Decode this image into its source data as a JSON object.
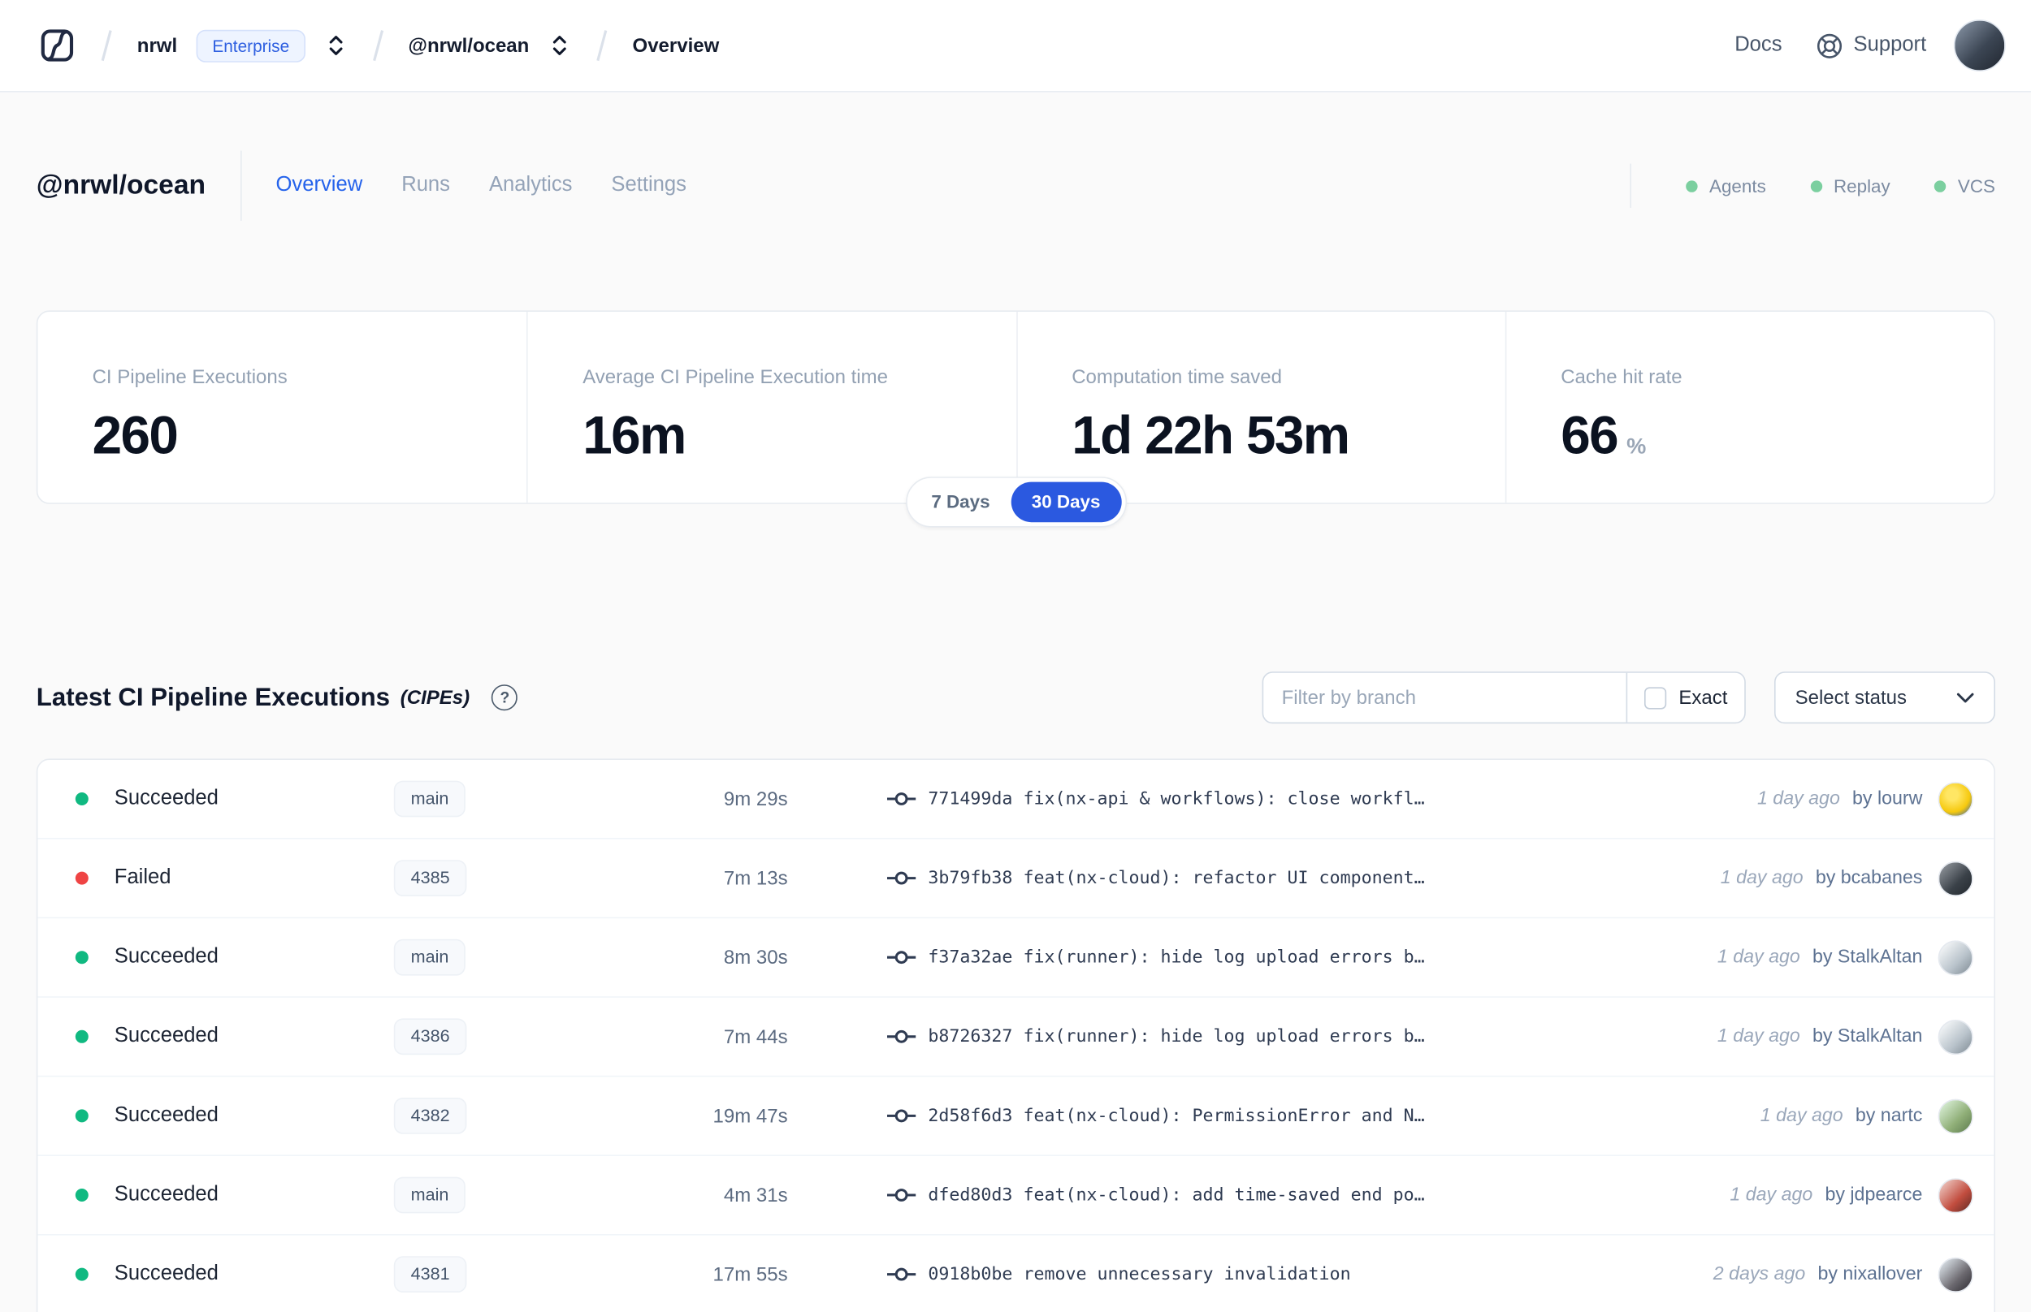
{
  "topbar": {
    "breadcrumb": {
      "org": "nrwl",
      "org_badge": "Enterprise",
      "workspace": "@nrwl/ocean",
      "page": "Overview"
    },
    "docs_label": "Docs",
    "support_label": "Support"
  },
  "workspace": {
    "title": "@nrwl/ocean",
    "tabs": [
      {
        "label": "Overview",
        "active": true
      },
      {
        "label": "Runs",
        "active": false
      },
      {
        "label": "Analytics",
        "active": false
      },
      {
        "label": "Settings",
        "active": false
      }
    ],
    "status_indicators": [
      {
        "label": "Agents"
      },
      {
        "label": "Replay"
      },
      {
        "label": "VCS"
      }
    ]
  },
  "stats": {
    "cards": [
      {
        "label": "CI Pipeline Executions",
        "value": "260"
      },
      {
        "label": "Average CI Pipeline Execution time",
        "value": "16m"
      },
      {
        "label": "Computation time saved",
        "value": "1d 22h 53m"
      },
      {
        "label": "Cache hit rate",
        "value": "66",
        "unit": "%"
      }
    ],
    "range_toggle": {
      "inactive": "7 Days",
      "active": "30 Days"
    }
  },
  "cipes": {
    "title": "Latest CI Pipeline Executions",
    "title_suffix": "(CIPEs)",
    "help_glyph": "?",
    "filter": {
      "placeholder": "Filter by branch",
      "exact_label": "Exact",
      "exact_checked": false
    },
    "status_select_label": "Select status",
    "rows": [
      {
        "status": "Succeeded",
        "status_color": "green",
        "branch": "main",
        "duration": "9m 29s",
        "commit": "771499da fix(nx-api & workflows): close workfl…",
        "time": "1 day ago",
        "author": "by lourw"
      },
      {
        "status": "Failed",
        "status_color": "red",
        "branch": "4385",
        "duration": "7m 13s",
        "commit": "3b79fb38 feat(nx-cloud): refactor UI component…",
        "time": "1 day ago",
        "author": "by bcabanes"
      },
      {
        "status": "Succeeded",
        "status_color": "green",
        "branch": "main",
        "duration": "8m 30s",
        "commit": "f37a32ae fix(runner): hide log upload errors b…",
        "time": "1 day ago",
        "author": "by StalkAltan"
      },
      {
        "status": "Succeeded",
        "status_color": "green",
        "branch": "4386",
        "duration": "7m 44s",
        "commit": "b8726327 fix(runner): hide log upload errors b…",
        "time": "1 day ago",
        "author": "by StalkAltan"
      },
      {
        "status": "Succeeded",
        "status_color": "green",
        "branch": "4382",
        "duration": "19m 47s",
        "commit": "2d58f6d3 feat(nx-cloud): PermissionError and N…",
        "time": "1 day ago",
        "author": "by nartc"
      },
      {
        "status": "Succeeded",
        "status_color": "green",
        "branch": "main",
        "duration": "4m 31s",
        "commit": "dfed80d3 feat(nx-cloud): add time-saved end po…",
        "time": "1 day ago",
        "author": "by jdpearce"
      },
      {
        "status": "Succeeded",
        "status_color": "green",
        "branch": "4381",
        "duration": "17m 55s",
        "commit": "0918b0be remove unnecessary invalidation",
        "time": "2 days ago",
        "author": "by nixallover"
      }
    ]
  },
  "colors": {
    "accent_blue": "#2563eb",
    "toggle_blue": "#2b59e0",
    "success_green": "#10b981",
    "failed_red": "#ef4444",
    "indicator_green": "#7bcf9f"
  }
}
